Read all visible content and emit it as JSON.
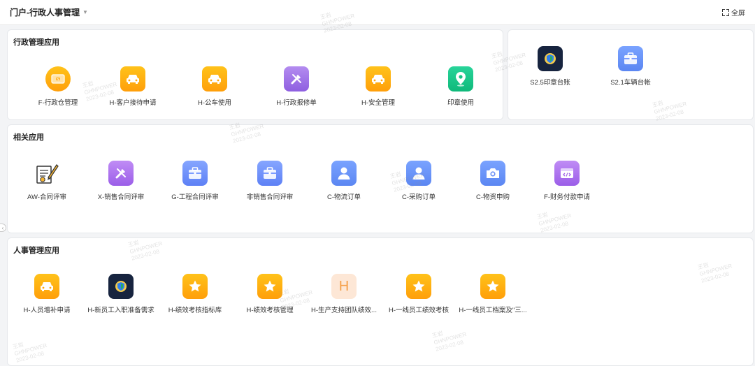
{
  "header": {
    "title": "门户-行政人事管理",
    "fullscreen_label": "全屏"
  },
  "sections": {
    "admin": {
      "title": "行政管理应用",
      "apps": [
        {
          "label": "F-行政仓管理",
          "icon": "money-icon"
        },
        {
          "label": "H-客户接待申请",
          "icon": "car-icon"
        },
        {
          "label": "H-公车使用",
          "icon": "car-icon"
        },
        {
          "label": "H-行政报修单",
          "icon": "tools-icon"
        },
        {
          "label": "H-安全管理",
          "icon": "car-icon"
        },
        {
          "label": "印章使用",
          "icon": "location-pin-icon"
        }
      ]
    },
    "ledger": {
      "apps": [
        {
          "label": "S2.5印章台账",
          "icon": "shield-icon"
        },
        {
          "label": "S2.1车辆台帐",
          "icon": "briefcase-icon"
        }
      ]
    },
    "related": {
      "title": "相关应用",
      "apps": [
        {
          "label": "AW-合同评审",
          "icon": "contract-sign-icon"
        },
        {
          "label": "X-销售合同评审",
          "icon": "tools-icon"
        },
        {
          "label": "G-工程合同评审",
          "icon": "briefcase-icon"
        },
        {
          "label": "非销售合同评审",
          "icon": "briefcase-icon"
        },
        {
          "label": "C-物流订单",
          "icon": "user-icon"
        },
        {
          "label": "C-采购订单",
          "icon": "user-icon"
        },
        {
          "label": "C-物资申购",
          "icon": "camera-icon"
        },
        {
          "label": "F-财务付款申请",
          "icon": "code-window-icon"
        }
      ]
    },
    "hr": {
      "title": "人事管理应用",
      "apps": [
        {
          "label": "H-人员增补申请",
          "icon": "car-icon"
        },
        {
          "label": "H-新员工入职准备需求",
          "icon": "shield-icon"
        },
        {
          "label": "H-绩效考核指标库",
          "icon": "star-icon"
        },
        {
          "label": "H-绩效考核管理",
          "icon": "star-icon"
        },
        {
          "label": "H-生产支持团队绩效...",
          "icon": "letter-h-icon",
          "letter": "H"
        },
        {
          "label": "H-一线员工绩效考核",
          "icon": "star-icon"
        },
        {
          "label": "H-一线员工档案及\"三...",
          "icon": "star-icon"
        }
      ]
    }
  },
  "watermark": {
    "line1": "王岩",
    "line2": "GHNPOWER",
    "line3": "2023-02-08"
  }
}
